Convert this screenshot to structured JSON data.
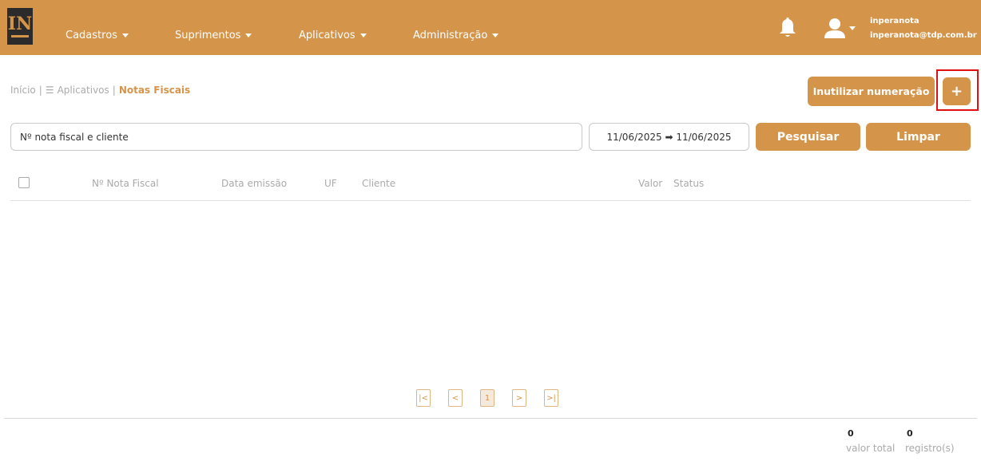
{
  "brand": {
    "logo_text": "IN",
    "color": "#d4944a"
  },
  "nav": {
    "items": [
      {
        "label": "Cadastros"
      },
      {
        "label": "Suprimentos"
      },
      {
        "label": "Aplicativos"
      },
      {
        "label": "Administração"
      }
    ],
    "user": {
      "name": "inperanota",
      "email": "inperanota@tdp.com.br"
    }
  },
  "breadcrumb": {
    "home": "Início",
    "apps": "Aplicativos",
    "current": "Notas Fiscais",
    "separator": "|"
  },
  "actions": {
    "inutilizar_label": "Inutilizar numeração",
    "add_label": "+"
  },
  "search": {
    "placeholder": "Nº nota fiscal e cliente",
    "date_range": "11/06/2025 ➡ 11/06/2025",
    "search_label": "Pesquisar",
    "clear_label": "Limpar"
  },
  "table": {
    "columns": [
      "Nº Nota Fiscal",
      "Data emissão",
      "UF",
      "Cliente",
      "Valor",
      "Status"
    ],
    "rows": []
  },
  "pagination": {
    "first": "|<",
    "prev": "<",
    "current_page": "1",
    "next": ">",
    "last": ">|"
  },
  "totals": {
    "valor_total": "0",
    "valor_total_label": "valor total",
    "registros": "0",
    "registros_label": "registro(s)"
  }
}
